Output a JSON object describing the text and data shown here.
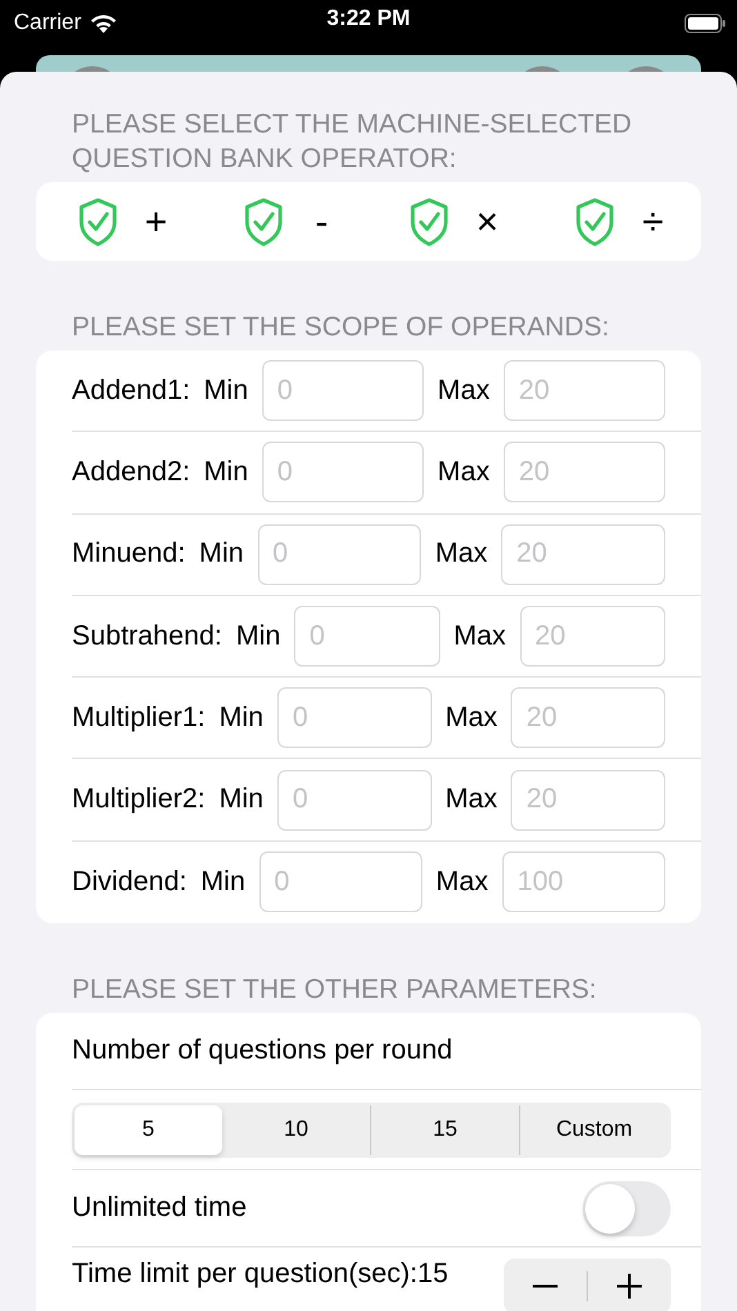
{
  "status_bar": {
    "carrier": "Carrier",
    "time": "3:22 PM"
  },
  "operator_section": {
    "header": "PLEASE SELECT THE MACHINE-SELECTED QUESTION BANK OPERATOR:",
    "operators": [
      {
        "symbol": "+",
        "checked": true
      },
      {
        "symbol": "-",
        "checked": true
      },
      {
        "symbol": "×",
        "checked": true
      },
      {
        "symbol": "÷",
        "checked": true
      }
    ]
  },
  "operand_section": {
    "header": "PLEASE SET THE SCOPE OF OPERANDS:",
    "rows": [
      {
        "label": "Addend1:",
        "min_label": "Min",
        "min_placeholder": "0",
        "max_label": "Max",
        "max_placeholder": "20"
      },
      {
        "label": "Addend2:",
        "min_label": "Min",
        "min_placeholder": "0",
        "max_label": "Max",
        "max_placeholder": "20"
      },
      {
        "label": "Minuend:",
        "min_label": "Min",
        "min_placeholder": "0",
        "max_label": "Max",
        "max_placeholder": "20"
      },
      {
        "label": "Subtrahend:",
        "min_label": "Min",
        "min_placeholder": "0",
        "max_label": "Max",
        "max_placeholder": "20"
      },
      {
        "label": "Multiplier1:",
        "min_label": "Min",
        "min_placeholder": "0",
        "max_label": "Max",
        "max_placeholder": "20"
      },
      {
        "label": "Multiplier2:",
        "min_label": "Min",
        "min_placeholder": "0",
        "max_label": "Max",
        "max_placeholder": "20"
      },
      {
        "label": "Dividend:",
        "min_label": "Min",
        "min_placeholder": "0",
        "max_label": "Max",
        "max_placeholder": "100"
      }
    ]
  },
  "parameters_section": {
    "header": "PLEASE SET THE OTHER PARAMETERS:",
    "question_count": {
      "label": "Number of questions per round",
      "options": [
        {
          "label": "5",
          "selected": true
        },
        {
          "label": "10",
          "selected": false
        },
        {
          "label": "15",
          "selected": false
        },
        {
          "label": "Custom",
          "selected": false
        }
      ]
    },
    "unlimited_time": {
      "label": "Unlimited time",
      "on": false
    },
    "time_limit": {
      "label": "Time limit per question(sec):15"
    }
  }
}
